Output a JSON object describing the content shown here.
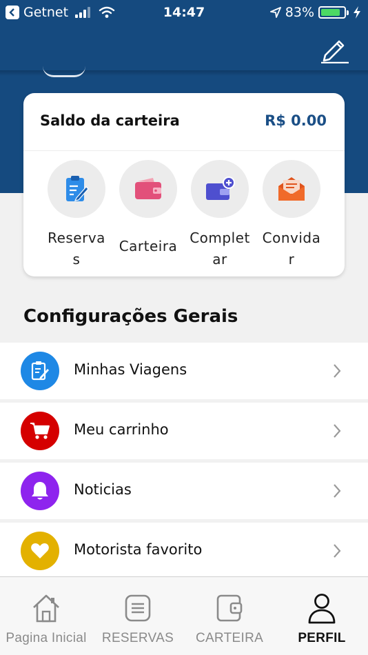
{
  "status_bar": {
    "carrier": "Getnet",
    "time": "14:47",
    "battery": "83%"
  },
  "header": {
    "edit_icon": "pencil-icon"
  },
  "wallet": {
    "title": "Saldo da carteira",
    "balance": "R$ 0.00",
    "actions": [
      {
        "label": "Reserva s",
        "icon": "clipboard-icon"
      },
      {
        "label": "Carteira",
        "icon": "wallet-icon"
      },
      {
        "label": "Complet ar",
        "icon": "add-card-icon"
      },
      {
        "label": "Convida r",
        "icon": "envelope-icon"
      }
    ]
  },
  "settings": {
    "title": "Configurações Gerais",
    "items": [
      {
        "label": "Minhas Viagens",
        "icon": "clipboard-icon",
        "color": "#1e88e5"
      },
      {
        "label": "Meu carrinho",
        "icon": "cart-icon",
        "color": "#d50000"
      },
      {
        "label": "Noticias",
        "icon": "bell-icon",
        "color": "#8e24ee"
      },
      {
        "label": "Motorista favorito",
        "icon": "heart-icon",
        "color": "#e3b100"
      }
    ]
  },
  "bottom_nav": {
    "items": [
      {
        "label": "Pagina Inicial",
        "icon": "home-icon",
        "active": false
      },
      {
        "label": "RESERVAS",
        "icon": "list-icon",
        "active": false
      },
      {
        "label": "CARTEIRA",
        "icon": "wallet-icon",
        "active": false
      },
      {
        "label": "PERFIL",
        "icon": "user-icon",
        "active": true
      }
    ]
  },
  "colors": {
    "header": "#154a7f",
    "balance": "#1b4f86",
    "background": "#f1f1f1"
  }
}
